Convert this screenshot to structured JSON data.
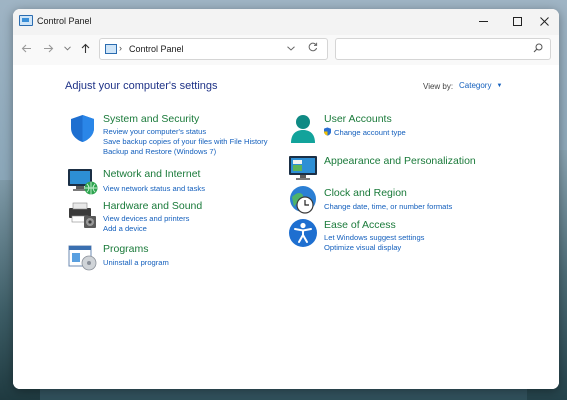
{
  "window": {
    "title": "Control Panel"
  },
  "navigation": {
    "back_icon": "arrow-left-icon",
    "forward_icon": "arrow-right-icon",
    "recent_icon": "chevron-down-icon",
    "up_icon": "arrow-up-icon",
    "address": {
      "separator": "›",
      "location": "Control Panel"
    },
    "search": {
      "placeholder": ""
    }
  },
  "content": {
    "heading": "Adjust your computer's settings",
    "view_by": {
      "label": "View by:",
      "value": "Category"
    },
    "categories_left": [
      {
        "title": "System and Security",
        "icon": "shield-icon",
        "links": [
          "Review your computer's status",
          "Save backup copies of your files with File History",
          "Backup and Restore (Windows 7)"
        ]
      },
      {
        "title": "Network and Internet",
        "icon": "network-icon",
        "links": [
          "View network status and tasks"
        ]
      },
      {
        "title": "Hardware and Sound",
        "icon": "printer-icon",
        "links": [
          "View devices and printers",
          "Add a device"
        ]
      },
      {
        "title": "Programs",
        "icon": "programs-icon",
        "links": [
          "Uninstall a program"
        ]
      }
    ],
    "categories_right": [
      {
        "title": "User Accounts",
        "icon": "user-icon",
        "links": [
          "Change account type"
        ]
      },
      {
        "title": "Appearance and Personalization",
        "icon": "monitor-icon",
        "links": []
      },
      {
        "title": "Clock and Region",
        "icon": "clock-globe-icon",
        "links": [
          "Change date, time, or number formats"
        ]
      },
      {
        "title": "Ease of Access",
        "icon": "accessibility-icon",
        "links": [
          "Let Windows suggest settings",
          "Optimize visual display"
        ]
      }
    ]
  },
  "colors": {
    "category_title": "#1a7a3a",
    "link": "#1560bd",
    "heading": "#1e3287"
  }
}
